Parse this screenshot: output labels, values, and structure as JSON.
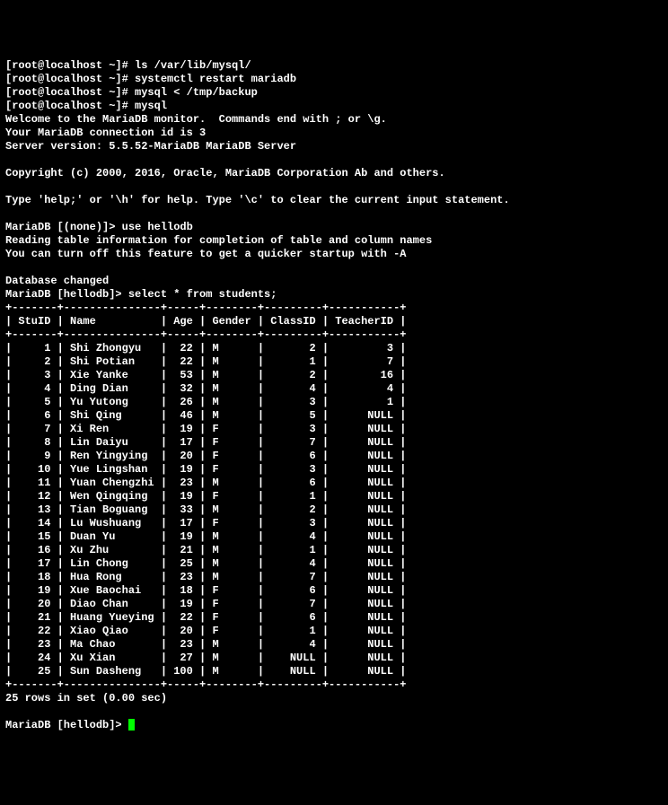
{
  "prompt_user": "root@localhost",
  "prompt_path": "~",
  "prompt_char": "#",
  "commands": [
    "ls /var/lib/mysql/",
    "systemctl restart mariadb",
    "mysql < /tmp/backup",
    "mysql"
  ],
  "welcome": [
    "Welcome to the MariaDB monitor.  Commands end with ; or \\g.",
    "Your MariaDB connection id is 3",
    "Server version: 5.5.52-MariaDB MariaDB Server",
    "",
    "Copyright (c) 2000, 2016, Oracle, MariaDB Corporation Ab and others.",
    "",
    "Type 'help;' or '\\h' for help. Type '\\c' to clear the current input statement.",
    ""
  ],
  "mariadb_prompt_none": "MariaDB [(none)]>",
  "use_cmd": "use hellodb",
  "reading_msg": [
    "Reading table information for completion of table and column names",
    "You can turn off this feature to get a quicker startup with -A",
    "",
    "Database changed"
  ],
  "mariadb_prompt_db": "MariaDB [hellodb]>",
  "select_cmd": "select * from students;",
  "table": {
    "columns": [
      "StuID",
      "Name",
      "Age",
      "Gender",
      "ClassID",
      "TeacherID"
    ],
    "rows": [
      {
        "StuID": "1",
        "Name": "Shi Zhongyu",
        "Age": "22",
        "Gender": "M",
        "ClassID": "2",
        "TeacherID": "3"
      },
      {
        "StuID": "2",
        "Name": "Shi Potian",
        "Age": "22",
        "Gender": "M",
        "ClassID": "1",
        "TeacherID": "7"
      },
      {
        "StuID": "3",
        "Name": "Xie Yanke",
        "Age": "53",
        "Gender": "M",
        "ClassID": "2",
        "TeacherID": "16"
      },
      {
        "StuID": "4",
        "Name": "Ding Dian",
        "Age": "32",
        "Gender": "M",
        "ClassID": "4",
        "TeacherID": "4"
      },
      {
        "StuID": "5",
        "Name": "Yu Yutong",
        "Age": "26",
        "Gender": "M",
        "ClassID": "3",
        "TeacherID": "1"
      },
      {
        "StuID": "6",
        "Name": "Shi Qing",
        "Age": "46",
        "Gender": "M",
        "ClassID": "5",
        "TeacherID": "NULL"
      },
      {
        "StuID": "7",
        "Name": "Xi Ren",
        "Age": "19",
        "Gender": "F",
        "ClassID": "3",
        "TeacherID": "NULL"
      },
      {
        "StuID": "8",
        "Name": "Lin Daiyu",
        "Age": "17",
        "Gender": "F",
        "ClassID": "7",
        "TeacherID": "NULL"
      },
      {
        "StuID": "9",
        "Name": "Ren Yingying",
        "Age": "20",
        "Gender": "F",
        "ClassID": "6",
        "TeacherID": "NULL"
      },
      {
        "StuID": "10",
        "Name": "Yue Lingshan",
        "Age": "19",
        "Gender": "F",
        "ClassID": "3",
        "TeacherID": "NULL"
      },
      {
        "StuID": "11",
        "Name": "Yuan Chengzhi",
        "Age": "23",
        "Gender": "M",
        "ClassID": "6",
        "TeacherID": "NULL"
      },
      {
        "StuID": "12",
        "Name": "Wen Qingqing",
        "Age": "19",
        "Gender": "F",
        "ClassID": "1",
        "TeacherID": "NULL"
      },
      {
        "StuID": "13",
        "Name": "Tian Boguang",
        "Age": "33",
        "Gender": "M",
        "ClassID": "2",
        "TeacherID": "NULL"
      },
      {
        "StuID": "14",
        "Name": "Lu Wushuang",
        "Age": "17",
        "Gender": "F",
        "ClassID": "3",
        "TeacherID": "NULL"
      },
      {
        "StuID": "15",
        "Name": "Duan Yu",
        "Age": "19",
        "Gender": "M",
        "ClassID": "4",
        "TeacherID": "NULL"
      },
      {
        "StuID": "16",
        "Name": "Xu Zhu",
        "Age": "21",
        "Gender": "M",
        "ClassID": "1",
        "TeacherID": "NULL"
      },
      {
        "StuID": "17",
        "Name": "Lin Chong",
        "Age": "25",
        "Gender": "M",
        "ClassID": "4",
        "TeacherID": "NULL"
      },
      {
        "StuID": "18",
        "Name": "Hua Rong",
        "Age": "23",
        "Gender": "M",
        "ClassID": "7",
        "TeacherID": "NULL"
      },
      {
        "StuID": "19",
        "Name": "Xue Baochai",
        "Age": "18",
        "Gender": "F",
        "ClassID": "6",
        "TeacherID": "NULL"
      },
      {
        "StuID": "20",
        "Name": "Diao Chan",
        "Age": "19",
        "Gender": "F",
        "ClassID": "7",
        "TeacherID": "NULL"
      },
      {
        "StuID": "21",
        "Name": "Huang Yueying",
        "Age": "22",
        "Gender": "F",
        "ClassID": "6",
        "TeacherID": "NULL"
      },
      {
        "StuID": "22",
        "Name": "Xiao Qiao",
        "Age": "20",
        "Gender": "F",
        "ClassID": "1",
        "TeacherID": "NULL"
      },
      {
        "StuID": "23",
        "Name": "Ma Chao",
        "Age": "23",
        "Gender": "M",
        "ClassID": "4",
        "TeacherID": "NULL"
      },
      {
        "StuID": "24",
        "Name": "Xu Xian",
        "Age": "27",
        "Gender": "M",
        "ClassID": "NULL",
        "TeacherID": "NULL"
      },
      {
        "StuID": "25",
        "Name": "Sun Dasheng",
        "Age": "100",
        "Gender": "M",
        "ClassID": "NULL",
        "TeacherID": "NULL"
      }
    ]
  },
  "result_summary": "25 rows in set (0.00 sec)",
  "border": "+-------+---------------+-----+--------+---------+-----------+",
  "header_row": "| StuID | Name          | Age | Gender | ClassID | TeacherID |"
}
